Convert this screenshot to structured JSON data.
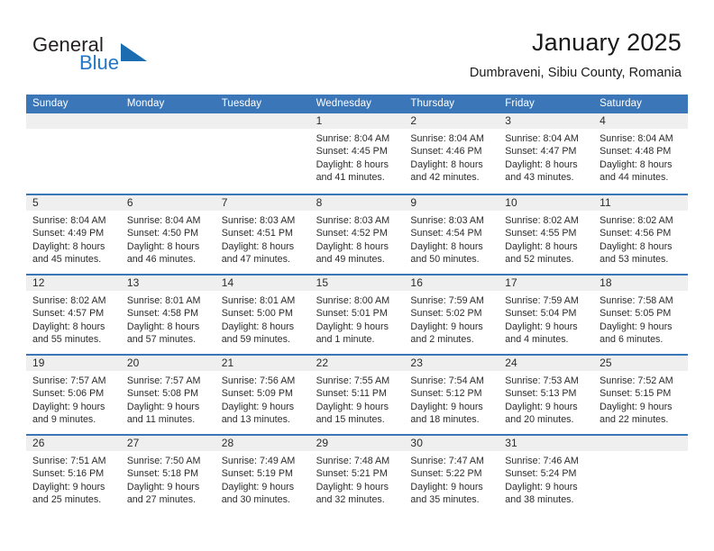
{
  "brand": {
    "name_part1": "General",
    "name_part2": "Blue",
    "triangle_icon": "triangle-logo-icon",
    "accent_color": "#1b6cb0",
    "text_color": "#231f20"
  },
  "header": {
    "title": "January 2025",
    "location": "Dumbraveni, Sibiu County, Romania"
  },
  "calendar": {
    "header_bg": "#3b77b8",
    "daynum_band_bg": "#efefef",
    "row_separator_color": "#3b77b8",
    "weekdays": [
      "Sunday",
      "Monday",
      "Tuesday",
      "Wednesday",
      "Thursday",
      "Friday",
      "Saturday"
    ],
    "weeks": [
      [
        {
          "day": "",
          "lines": []
        },
        {
          "day": "",
          "lines": []
        },
        {
          "day": "",
          "lines": []
        },
        {
          "day": "1",
          "lines": [
            "Sunrise: 8:04 AM",
            "Sunset: 4:45 PM",
            "Daylight: 8 hours",
            "and 41 minutes."
          ]
        },
        {
          "day": "2",
          "lines": [
            "Sunrise: 8:04 AM",
            "Sunset: 4:46 PM",
            "Daylight: 8 hours",
            "and 42 minutes."
          ]
        },
        {
          "day": "3",
          "lines": [
            "Sunrise: 8:04 AM",
            "Sunset: 4:47 PM",
            "Daylight: 8 hours",
            "and 43 minutes."
          ]
        },
        {
          "day": "4",
          "lines": [
            "Sunrise: 8:04 AM",
            "Sunset: 4:48 PM",
            "Daylight: 8 hours",
            "and 44 minutes."
          ]
        }
      ],
      [
        {
          "day": "5",
          "lines": [
            "Sunrise: 8:04 AM",
            "Sunset: 4:49 PM",
            "Daylight: 8 hours",
            "and 45 minutes."
          ]
        },
        {
          "day": "6",
          "lines": [
            "Sunrise: 8:04 AM",
            "Sunset: 4:50 PM",
            "Daylight: 8 hours",
            "and 46 minutes."
          ]
        },
        {
          "day": "7",
          "lines": [
            "Sunrise: 8:03 AM",
            "Sunset: 4:51 PM",
            "Daylight: 8 hours",
            "and 47 minutes."
          ]
        },
        {
          "day": "8",
          "lines": [
            "Sunrise: 8:03 AM",
            "Sunset: 4:52 PM",
            "Daylight: 8 hours",
            "and 49 minutes."
          ]
        },
        {
          "day": "9",
          "lines": [
            "Sunrise: 8:03 AM",
            "Sunset: 4:54 PM",
            "Daylight: 8 hours",
            "and 50 minutes."
          ]
        },
        {
          "day": "10",
          "lines": [
            "Sunrise: 8:02 AM",
            "Sunset: 4:55 PM",
            "Daylight: 8 hours",
            "and 52 minutes."
          ]
        },
        {
          "day": "11",
          "lines": [
            "Sunrise: 8:02 AM",
            "Sunset: 4:56 PM",
            "Daylight: 8 hours",
            "and 53 minutes."
          ]
        }
      ],
      [
        {
          "day": "12",
          "lines": [
            "Sunrise: 8:02 AM",
            "Sunset: 4:57 PM",
            "Daylight: 8 hours",
            "and 55 minutes."
          ]
        },
        {
          "day": "13",
          "lines": [
            "Sunrise: 8:01 AM",
            "Sunset: 4:58 PM",
            "Daylight: 8 hours",
            "and 57 minutes."
          ]
        },
        {
          "day": "14",
          "lines": [
            "Sunrise: 8:01 AM",
            "Sunset: 5:00 PM",
            "Daylight: 8 hours",
            "and 59 minutes."
          ]
        },
        {
          "day": "15",
          "lines": [
            "Sunrise: 8:00 AM",
            "Sunset: 5:01 PM",
            "Daylight: 9 hours",
            "and 1 minute."
          ]
        },
        {
          "day": "16",
          "lines": [
            "Sunrise: 7:59 AM",
            "Sunset: 5:02 PM",
            "Daylight: 9 hours",
            "and 2 minutes."
          ]
        },
        {
          "day": "17",
          "lines": [
            "Sunrise: 7:59 AM",
            "Sunset: 5:04 PM",
            "Daylight: 9 hours",
            "and 4 minutes."
          ]
        },
        {
          "day": "18",
          "lines": [
            "Sunrise: 7:58 AM",
            "Sunset: 5:05 PM",
            "Daylight: 9 hours",
            "and 6 minutes."
          ]
        }
      ],
      [
        {
          "day": "19",
          "lines": [
            "Sunrise: 7:57 AM",
            "Sunset: 5:06 PM",
            "Daylight: 9 hours",
            "and 9 minutes."
          ]
        },
        {
          "day": "20",
          "lines": [
            "Sunrise: 7:57 AM",
            "Sunset: 5:08 PM",
            "Daylight: 9 hours",
            "and 11 minutes."
          ]
        },
        {
          "day": "21",
          "lines": [
            "Sunrise: 7:56 AM",
            "Sunset: 5:09 PM",
            "Daylight: 9 hours",
            "and 13 minutes."
          ]
        },
        {
          "day": "22",
          "lines": [
            "Sunrise: 7:55 AM",
            "Sunset: 5:11 PM",
            "Daylight: 9 hours",
            "and 15 minutes."
          ]
        },
        {
          "day": "23",
          "lines": [
            "Sunrise: 7:54 AM",
            "Sunset: 5:12 PM",
            "Daylight: 9 hours",
            "and 18 minutes."
          ]
        },
        {
          "day": "24",
          "lines": [
            "Sunrise: 7:53 AM",
            "Sunset: 5:13 PM",
            "Daylight: 9 hours",
            "and 20 minutes."
          ]
        },
        {
          "day": "25",
          "lines": [
            "Sunrise: 7:52 AM",
            "Sunset: 5:15 PM",
            "Daylight: 9 hours",
            "and 22 minutes."
          ]
        }
      ],
      [
        {
          "day": "26",
          "lines": [
            "Sunrise: 7:51 AM",
            "Sunset: 5:16 PM",
            "Daylight: 9 hours",
            "and 25 minutes."
          ]
        },
        {
          "day": "27",
          "lines": [
            "Sunrise: 7:50 AM",
            "Sunset: 5:18 PM",
            "Daylight: 9 hours",
            "and 27 minutes."
          ]
        },
        {
          "day": "28",
          "lines": [
            "Sunrise: 7:49 AM",
            "Sunset: 5:19 PM",
            "Daylight: 9 hours",
            "and 30 minutes."
          ]
        },
        {
          "day": "29",
          "lines": [
            "Sunrise: 7:48 AM",
            "Sunset: 5:21 PM",
            "Daylight: 9 hours",
            "and 32 minutes."
          ]
        },
        {
          "day": "30",
          "lines": [
            "Sunrise: 7:47 AM",
            "Sunset: 5:22 PM",
            "Daylight: 9 hours",
            "and 35 minutes."
          ]
        },
        {
          "day": "31",
          "lines": [
            "Sunrise: 7:46 AM",
            "Sunset: 5:24 PM",
            "Daylight: 9 hours",
            "and 38 minutes."
          ]
        },
        {
          "day": "",
          "lines": []
        }
      ]
    ]
  }
}
